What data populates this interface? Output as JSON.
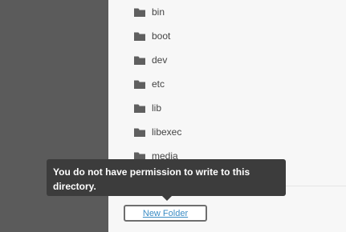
{
  "folders": [
    {
      "name": "bin",
      "icon": "folder-icon"
    },
    {
      "name": "boot",
      "icon": "folder-icon"
    },
    {
      "name": "dev",
      "icon": "folder-icon"
    },
    {
      "name": "etc",
      "icon": "folder-icon"
    },
    {
      "name": "lib",
      "icon": "folder-icon"
    },
    {
      "name": "libexec",
      "icon": "folder-icon"
    },
    {
      "name": "media",
      "icon": "folder-icon"
    }
  ],
  "tooltip": {
    "text": "You do not have permission to write to this directory."
  },
  "actions": {
    "new_folder_label": "New Folder"
  },
  "colors": {
    "left_pane": "#5b5b5b",
    "right_pane": "#f7f7f7",
    "folder_icon": "#5f5f5f",
    "link": "#3a8cc4",
    "tooltip_bg": "#3c3c3c"
  }
}
